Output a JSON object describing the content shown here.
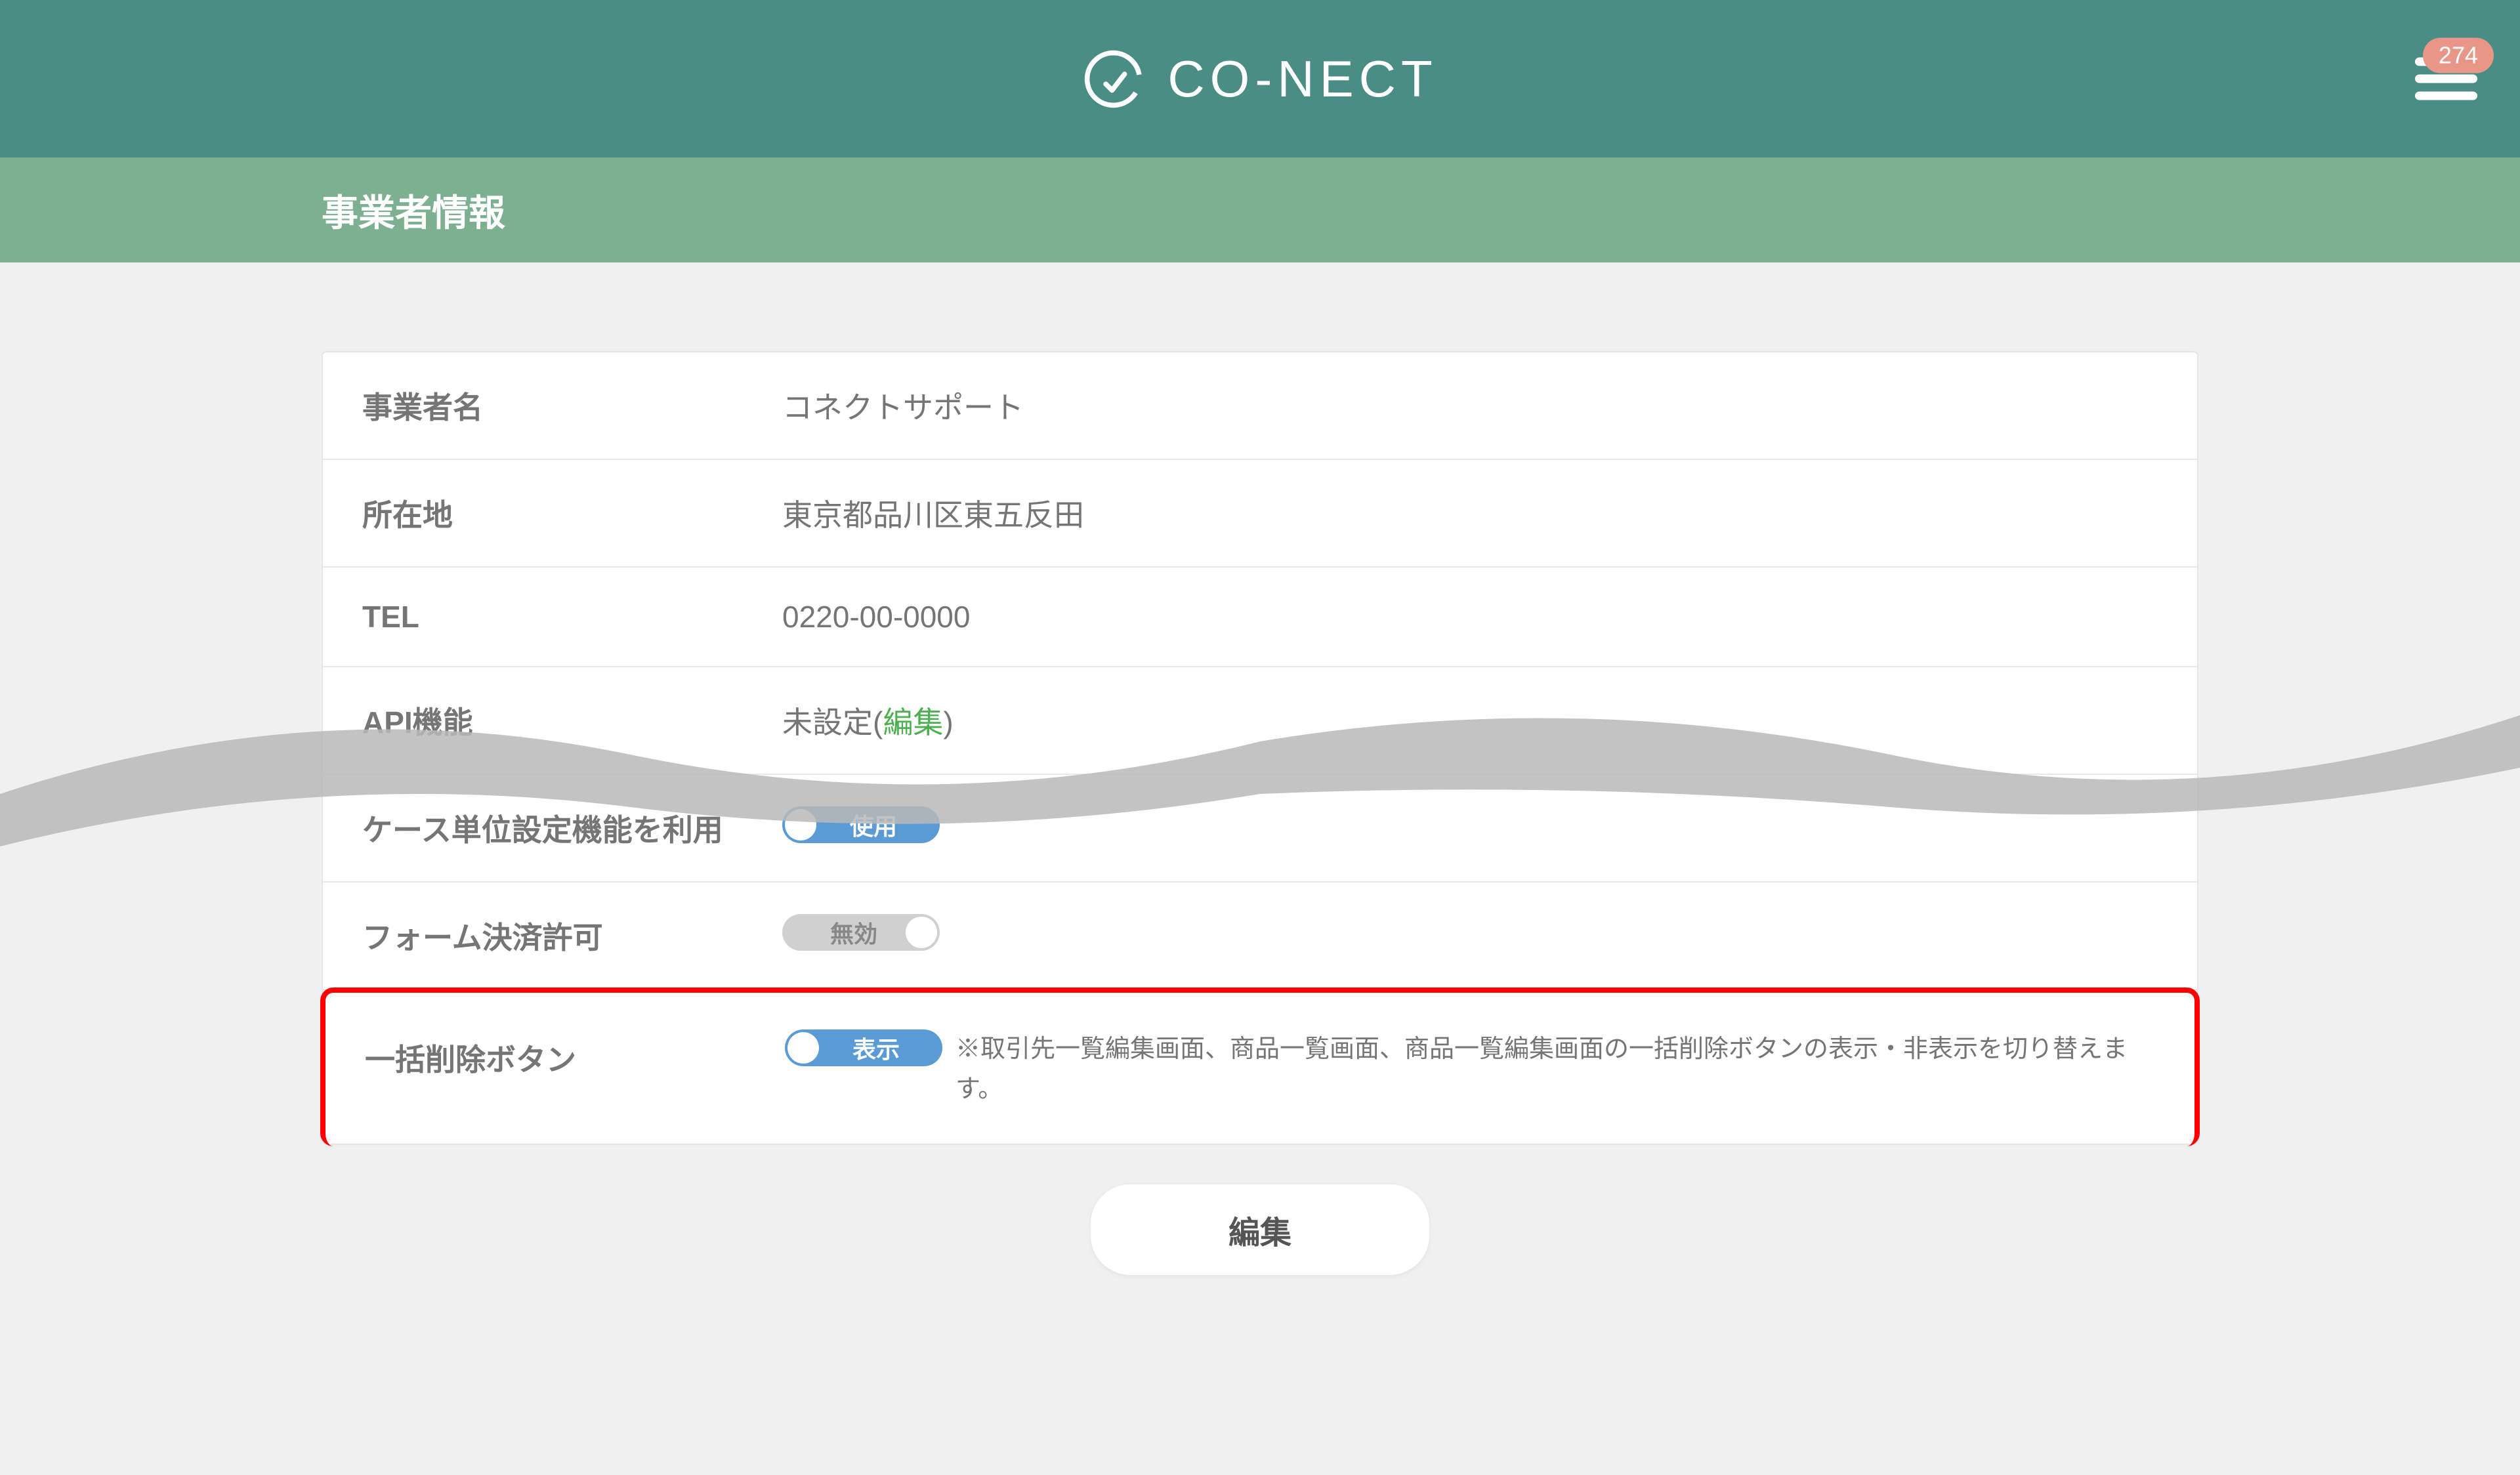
{
  "header": {
    "brand": "CO-NECT",
    "notification_count": "274"
  },
  "page": {
    "title": "事業者情報"
  },
  "fields": {
    "company_name": {
      "label": "事業者名",
      "value": "コネクトサポート"
    },
    "address": {
      "label": "所在地",
      "value": "東京都品川区東五反田"
    },
    "tel": {
      "label": "TEL",
      "value": "0220-00-0000"
    },
    "api": {
      "label": "API機能",
      "value_prefix": "未設定(",
      "edit_link": "編集",
      "value_suffix": ")"
    },
    "case_unit": {
      "label": "ケース単位設定機能を利用",
      "toggle": "使用"
    },
    "form_payment": {
      "label": "フォーム決済許可",
      "toggle": "無効"
    },
    "bulk_delete": {
      "label": "一括削除ボタン",
      "toggle": "表示",
      "note": "※取引先一覧編集画面、商品一覧画面、商品一覧編集画面の一括削除ボタンの表示・非表示を切り替えます。"
    }
  },
  "buttons": {
    "edit": "編集"
  }
}
